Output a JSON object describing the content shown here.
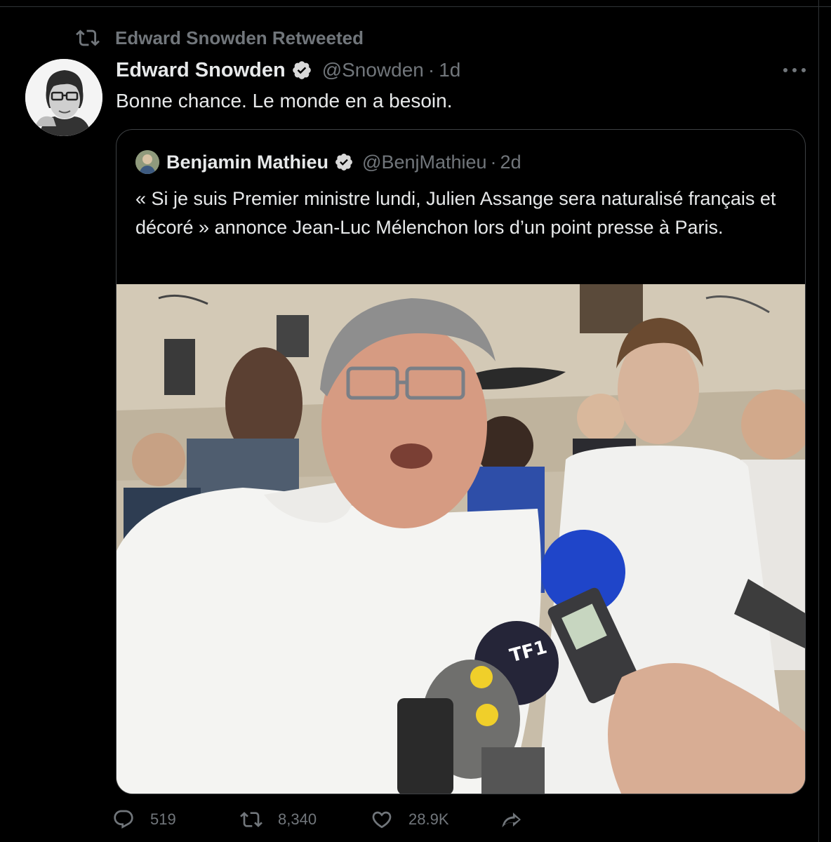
{
  "retweet_context": {
    "label": "Edward Snowden Retweeted",
    "icon": "retweet-icon"
  },
  "tweet": {
    "author_name": "Edward Snowden",
    "handle": "@Snowden",
    "separator": "·",
    "timestamp": "1d",
    "text": "Bonne chance. Le monde en a besoin."
  },
  "quoted_tweet": {
    "author_name": "Benjamin Mathieu",
    "handle": "@BenjMathieu",
    "separator": "·",
    "timestamp": "2d",
    "text": "« Si je suis Premier ministre lundi, Julien Assange sera naturalisé français et décoré » annonce Jean-Luc Mélenchon lors d’un point presse à Paris."
  },
  "actions": {
    "replies": "519",
    "retweets": "8,340",
    "likes": "28.9K"
  },
  "colors": {
    "background": "#000000",
    "text_primary": "#e7e9ea",
    "text_secondary": "#71767b",
    "border": "#3e4144"
  }
}
